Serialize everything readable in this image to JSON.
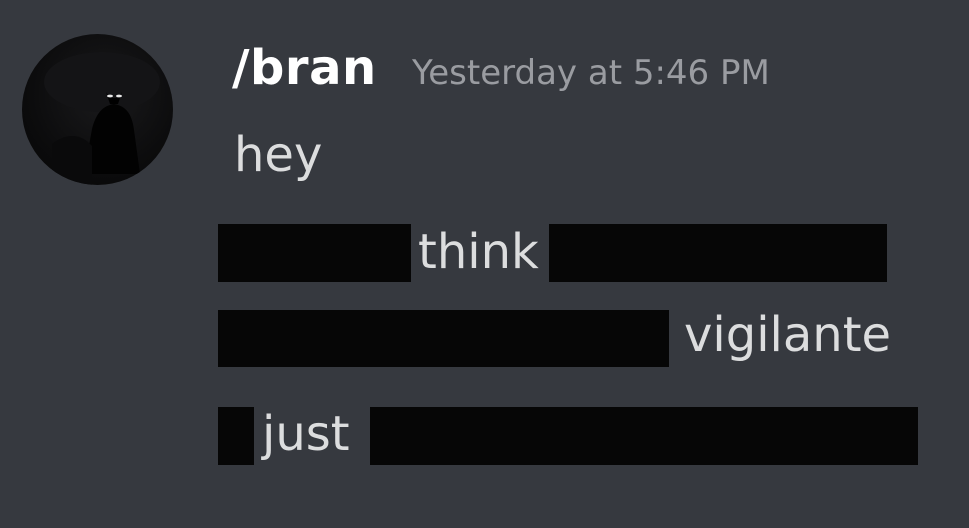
{
  "message": {
    "author": "/bran",
    "timestamp": "Yesterday at 5:46 PM",
    "avatar_icon": "dark-silhouette-avatar",
    "lines": [
      {
        "text": "hey"
      },
      {
        "words": [
          "think"
        ]
      },
      {
        "words": [
          "vigilante"
        ]
      },
      {
        "words": [
          "just"
        ]
      }
    ]
  }
}
